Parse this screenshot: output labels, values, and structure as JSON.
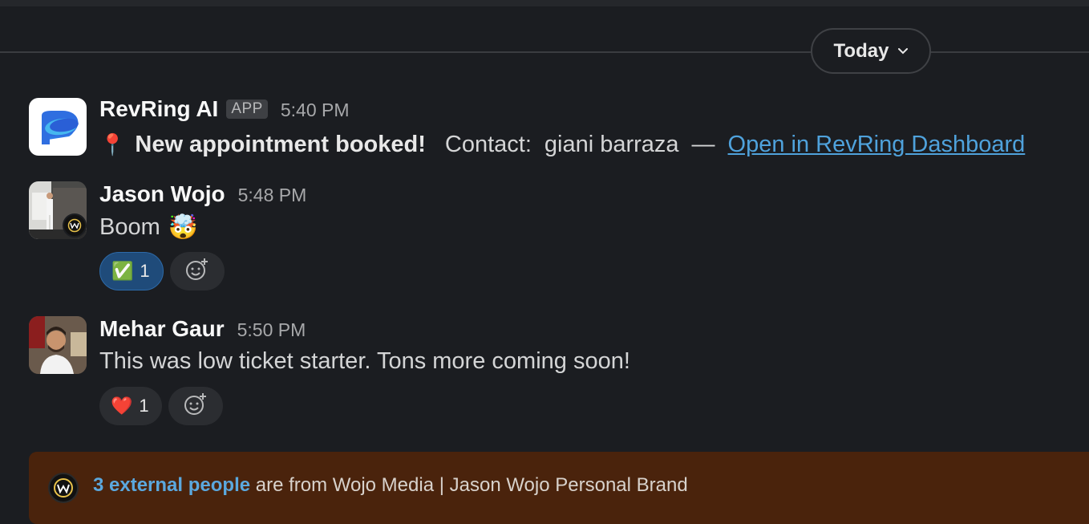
{
  "date_divider": {
    "label": "Today"
  },
  "messages": [
    {
      "sender": "RevRing AI",
      "badge": "APP",
      "time": "5:40 PM",
      "pin_emoji": "📍",
      "headline": "New appointment booked!",
      "contact_label": "Contact:",
      "contact_name": "giani barraza",
      "dash": "—",
      "link_text": "Open in RevRing Dashboard"
    },
    {
      "sender": "Jason Wojo",
      "time": "5:48 PM",
      "text": "Boom",
      "emoji": "🤯",
      "reactions": [
        {
          "emoji": "✅",
          "count": "1",
          "active": true
        }
      ]
    },
    {
      "sender": "Mehar Gaur",
      "time": "5:50 PM",
      "text": "This was low ticket starter. Tons more coming soon!",
      "reactions": [
        {
          "emoji": "❤️",
          "count": "1",
          "active": false
        }
      ]
    }
  ],
  "banner": {
    "link_text": "3 external people",
    "rest_text": " are from Wojo Media | Jason Wojo Personal Brand"
  },
  "colors": {
    "background": "#1b1d21",
    "link": "#4fa2dc",
    "banner": "#4a230c",
    "active_reaction": "#1f4b7a"
  }
}
